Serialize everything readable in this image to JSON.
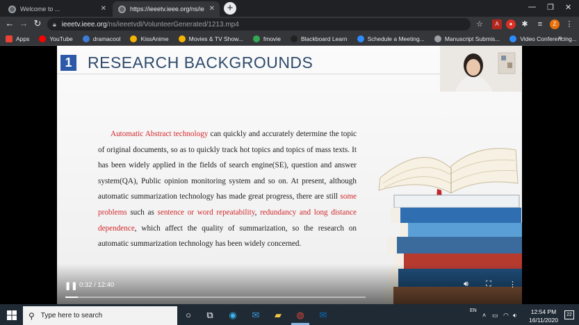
{
  "browser": {
    "tabs": [
      {
        "title": "Welcome to ..."
      },
      {
        "title": "https://ieeetv.ieee.org/ns/ie"
      }
    ],
    "new_tab": "+",
    "url_host": "ieeetv.ieee.org",
    "url_path": "/ns/ieeetvdl/VolunteerGenerated/1213.mp4",
    "bookmarks": [
      {
        "label": "Apps",
        "icon": "apps-grid-icon",
        "color": "#ea4335"
      },
      {
        "label": "YouTube",
        "icon": "youtube-icon",
        "color": "#ff0000"
      },
      {
        "label": "dramacool",
        "icon": "dramacool-icon",
        "color": "#3b7dd8"
      },
      {
        "label": "KissAnime",
        "icon": "kissanime-icon",
        "color": "#f4b400"
      },
      {
        "label": "Movies & TV Show...",
        "icon": "movies-icon",
        "color": "#f4b400"
      },
      {
        "label": "fmovie",
        "icon": "fmovie-icon",
        "color": "#34a853"
      },
      {
        "label": "Blackboard Learn",
        "icon": "blackboard-icon",
        "color": "#222222"
      },
      {
        "label": "Schedule a Meeting...",
        "icon": "zoom-icon",
        "color": "#2d8cff"
      },
      {
        "label": "Manuscript Submis...",
        "icon": "globe-icon",
        "color": "#9aa0a6"
      },
      {
        "label": "Video Conferencing...",
        "icon": "zoom-icon",
        "color": "#2d8cff"
      }
    ],
    "bookmarks_overflow": "»",
    "profile_initial": "Z"
  },
  "slide": {
    "number": "1",
    "title": "RESEARCH BACKGROUNDS",
    "paragraph": [
      {
        "text": "Automatic Abstract technology",
        "red": true
      },
      {
        "text": " can quickly and accurately determine the topic of original documents, so as to quickly track hot topics and topics of mass texts. It has been widely applied in the fields of search engine(SE), question and answer system(QA), Public opinion monitoring system and so on. At present, although automatic summarization technology has made great progress, there are still ",
        "red": false
      },
      {
        "text": "some problems",
        "red": true
      },
      {
        "text": " such as ",
        "red": false
      },
      {
        "text": "sentence or word repeatability",
        "red": true
      },
      {
        "text": ", ",
        "red": false
      },
      {
        "text": "redundancy and long distance dependence",
        "red": true
      },
      {
        "text": ", which affect the quality of summarization, so the research on automatic summarization technology has been widely concerned.",
        "red": false
      }
    ],
    "accent_color": "#d3262a",
    "number_box_color": "#2d5aa8"
  },
  "player": {
    "time": "0:32 / 12:40",
    "progress_fraction": 0.042
  },
  "taskbar": {
    "search_placeholder": "Type here to search",
    "lang": "EN",
    "time": "12:54 PM",
    "date": "16/11/2020",
    "notifications": "22"
  }
}
